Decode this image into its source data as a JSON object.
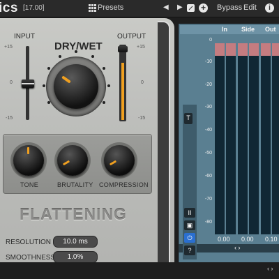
{
  "header": {
    "title": "ics",
    "version": "[17.00]",
    "presets_label": "Presets",
    "prev_glyph": "◀",
    "next_glyph": "▶",
    "bypass_label": "Bypass",
    "edit_label": "Edit",
    "info_glyph": "i",
    "add_glyph": "+"
  },
  "panel": {
    "input_label": "INPUT",
    "output_label": "OUTPUT",
    "drywet_title": "DRY/WET",
    "input_ticks": [
      "+15",
      "0",
      "-15"
    ],
    "output_ticks": [
      "+15",
      "0",
      "-15"
    ],
    "knobs": [
      {
        "label": "TONE"
      },
      {
        "label": "BRUTALITY"
      },
      {
        "label": "COMPRESSION"
      }
    ],
    "section_title": "FLATTENING",
    "resolution_label": "RESOLUTION",
    "resolution_value": "10.0 ms",
    "smoothness_label": "SMOOTHNESS",
    "smoothness_value": "1.0%"
  },
  "meters": {
    "headers": [
      "In",
      "Side",
      "Out"
    ],
    "scale": [
      "0",
      "-10",
      "-20",
      "-30",
      "-40",
      "-50",
      "-60",
      "-70",
      "-80"
    ],
    "values": [
      "0.00",
      "0.00",
      "0.10"
    ],
    "nav_glyph": "‹ ›",
    "tools": {
      "pause": "II",
      "layout": "▣",
      "power": "⏻",
      "help": "?",
      "toggle": "T"
    }
  },
  "colors": {
    "accent": "#f0a020",
    "meter_peak": "#c47c80",
    "meter_bg": "#102734",
    "panel_blue": "#5a7f91"
  }
}
